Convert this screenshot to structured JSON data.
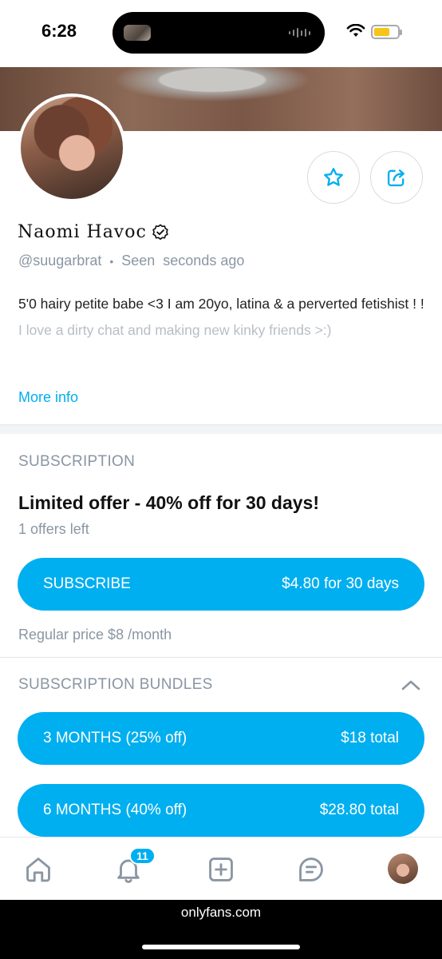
{
  "status_bar": {
    "time": "6:28"
  },
  "profile": {
    "name": "Naomi Havoc",
    "handle": "@suugarbrat",
    "seen_label": "Seen",
    "seen_time": "seconds ago",
    "bio_line1": "5'0 hairy petite babe <3 I am 20yo, latina & a perverted fetishist ! !",
    "bio_line2": "I love a dirty chat and making new kinky friends >:)",
    "more_info": "More info"
  },
  "subscription": {
    "title": "SUBSCRIPTION",
    "offer": "Limited offer - 40% off for 30 days!",
    "offers_left": "1 offers left",
    "button_label": "SUBSCRIBE",
    "button_price": "$4.80 for 30 days",
    "regular_price": "Regular price $8 /month"
  },
  "bundles": {
    "title": "SUBSCRIPTION BUNDLES",
    "items": [
      {
        "label": "3 MONTHS (25% off)",
        "price": "$18 total"
      },
      {
        "label": "6 MONTHS (40% off)",
        "price": "$28.80 total"
      }
    ]
  },
  "tabbar": {
    "notification_count": "11"
  },
  "browser": {
    "url": "onlyfans.com"
  },
  "colors": {
    "accent": "#00aff0",
    "muted": "#8a96a3"
  },
  "icons": [
    "wifi-icon",
    "battery-icon",
    "star-icon",
    "share-icon",
    "verified-icon",
    "chevron-up-icon",
    "home-icon",
    "bell-icon",
    "add-icon",
    "chat-icon"
  ]
}
